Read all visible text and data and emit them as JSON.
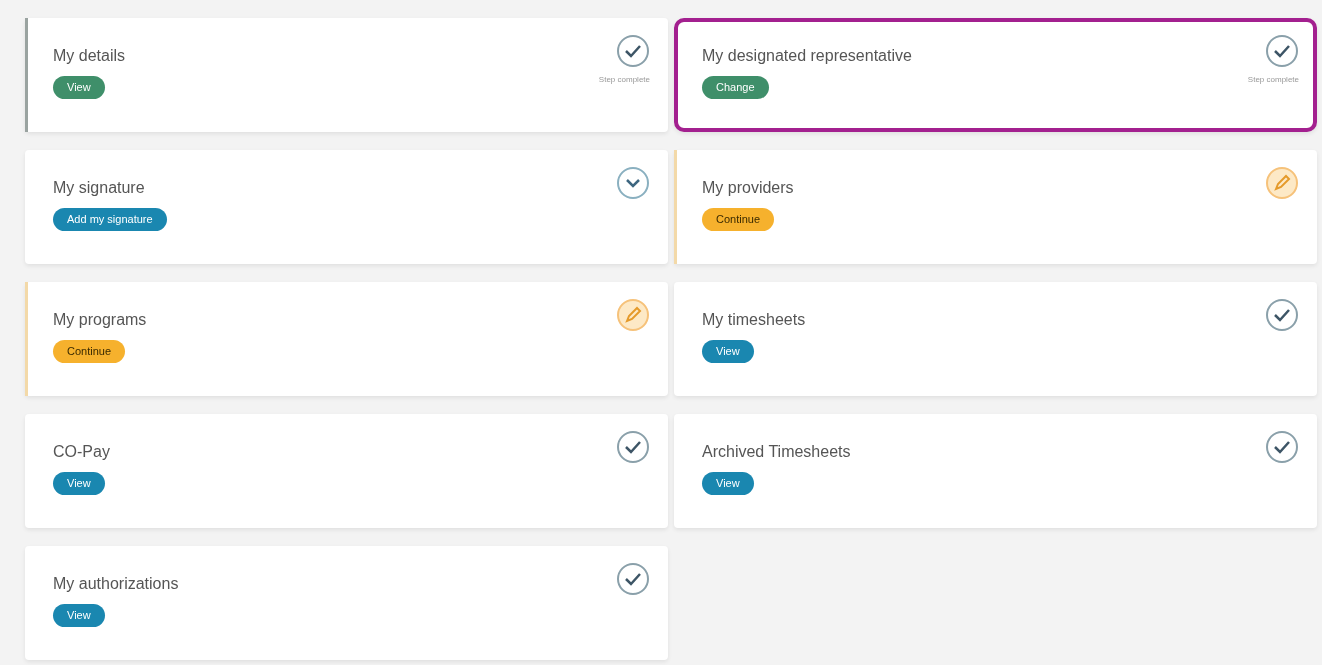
{
  "cards": [
    {
      "title": "My details",
      "button": {
        "label": "View",
        "kind": "green"
      },
      "status": {
        "kind": "check"
      },
      "note": "Step complete",
      "color": "#9aa3a0",
      "highlighted": false
    },
    {
      "title": "My designated representative",
      "button": {
        "label": "Change",
        "kind": "green"
      },
      "status": {
        "kind": "check"
      },
      "note": "Step complete",
      "highlighted": true
    },
    {
      "title": "My signature",
      "button": {
        "label": "Add my signature",
        "kind": "blue"
      },
      "status": {
        "kind": "chevron"
      },
      "highlighted": false
    },
    {
      "title": "My providers",
      "button": {
        "label": "Continue",
        "kind": "orange"
      },
      "status": {
        "kind": "pencil"
      },
      "color": "#f3d9a8",
      "highlighted": false
    },
    {
      "title": "My programs",
      "button": {
        "label": "Continue",
        "kind": "orange"
      },
      "status": {
        "kind": "pencil"
      },
      "color": "#f3d9a8",
      "highlighted": false
    },
    {
      "title": "My timesheets",
      "button": {
        "label": "View",
        "kind": "blue"
      },
      "status": {
        "kind": "check"
      },
      "highlighted": false
    },
    {
      "title": "CO-Pay",
      "button": {
        "label": "View",
        "kind": "blue"
      },
      "status": {
        "kind": "check"
      },
      "highlighted": false
    },
    {
      "title": "Archived Timesheets",
      "button": {
        "label": "View",
        "kind": "blue"
      },
      "status": {
        "kind": "check"
      },
      "highlighted": false
    },
    {
      "title": "My authorizations",
      "button": {
        "label": "View",
        "kind": "blue"
      },
      "status": {
        "kind": "check"
      },
      "highlighted": false
    }
  ]
}
